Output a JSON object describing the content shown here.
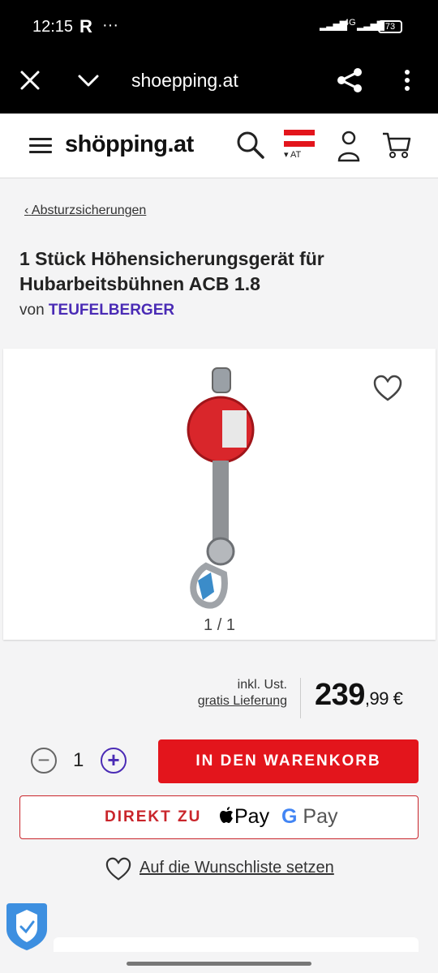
{
  "status_bar": {
    "time": "12:15",
    "app_icon": "R",
    "more": "···",
    "network": "4G",
    "battery": "73"
  },
  "browser": {
    "url": "shoepping.at",
    "icons": [
      "close-icon",
      "chevron-down-icon",
      "share-icon",
      "more-vert-icon"
    ]
  },
  "site_header": {
    "logo": "shöpping.at",
    "country": "AT",
    "icons": [
      "menu-icon",
      "search-icon",
      "flag-icon",
      "user-icon",
      "cart-icon"
    ]
  },
  "breadcrumb": {
    "label": "Absturzsicherungen"
  },
  "product": {
    "title": "1 Stück Höhensicherungsgerät für Hubarbeitsbühnen ACB 1.8",
    "by_prefix": "von",
    "brand": "TEUFELBERGER",
    "image_counter": "1 / 1"
  },
  "price": {
    "tax_note": "inkl. Ust.",
    "delivery": "gratis Lieferung",
    "euros": "239",
    "cents": ",99 €"
  },
  "quantity": {
    "value": "1"
  },
  "buttons": {
    "add_to_cart": "IN DEN WARENKORB",
    "direct_prefix": "DIREKT ZU",
    "apple_pay": "Pay",
    "google_pay": "Pay"
  },
  "wishlist": {
    "label": "Auf die Wunschliste setzen"
  },
  "colors": {
    "accent_red": "#e3151c",
    "brand_purple": "#4a2bb5"
  }
}
